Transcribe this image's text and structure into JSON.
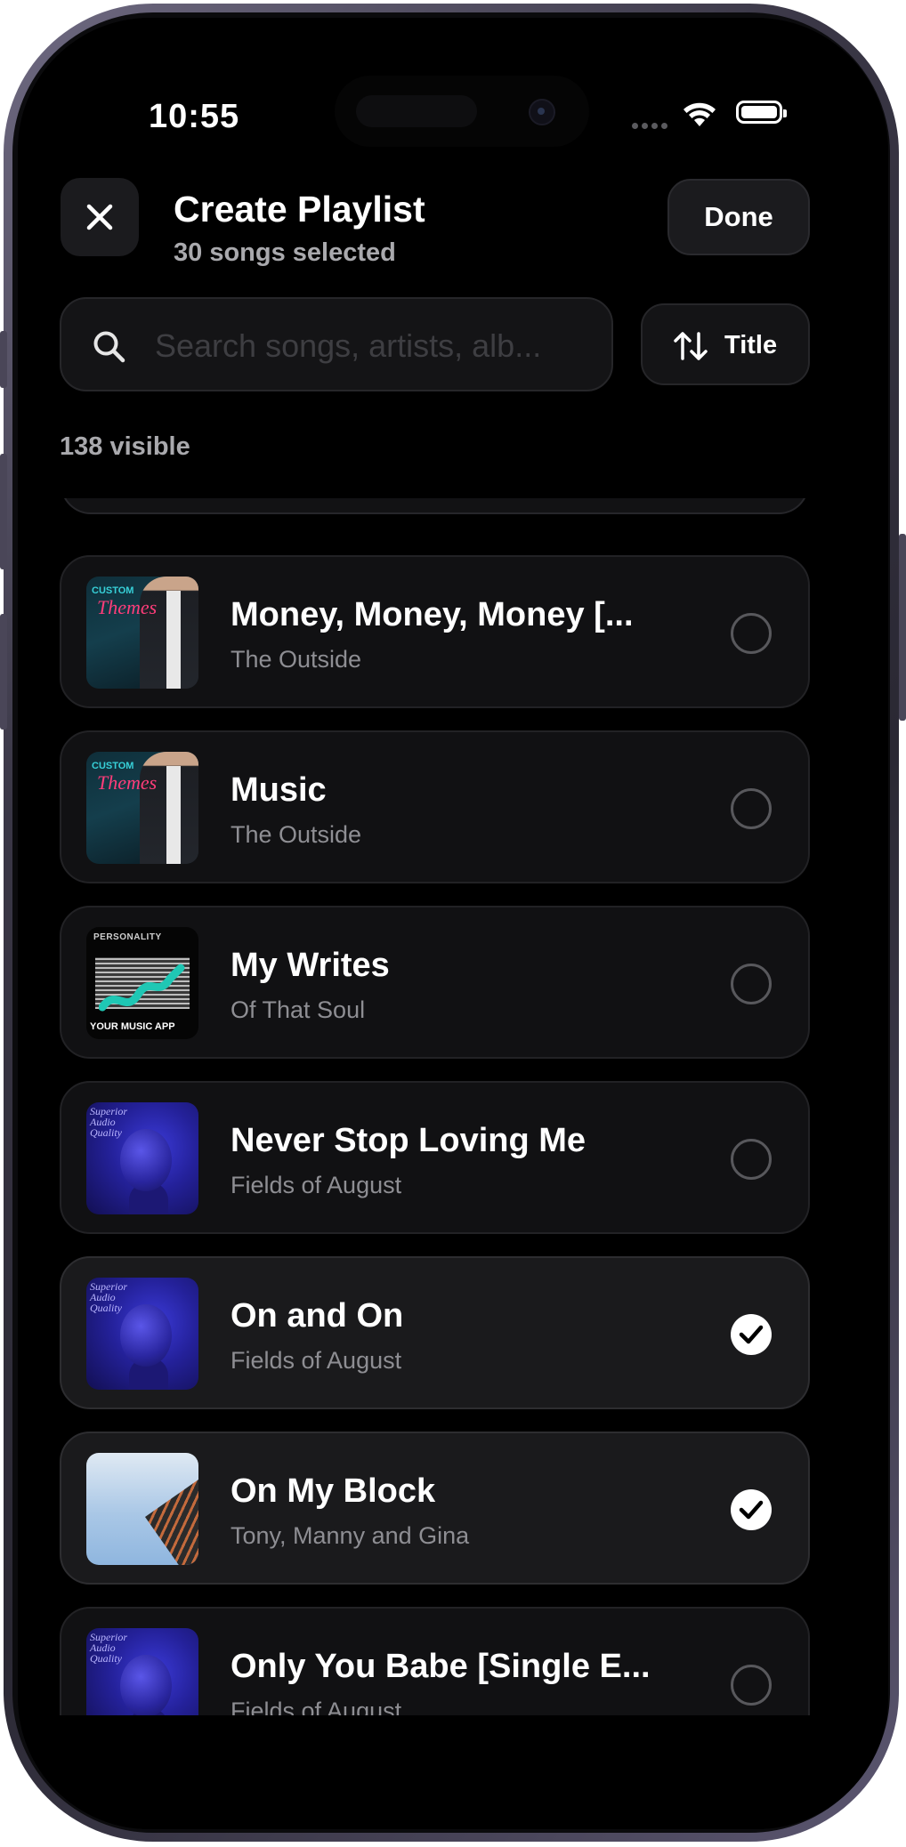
{
  "status_bar": {
    "time": "10:55"
  },
  "header": {
    "title": "Create Playlist",
    "subtitle": "30 songs selected",
    "done_label": "Done"
  },
  "search": {
    "placeholder": "Search songs, artists, alb...",
    "value": ""
  },
  "sort": {
    "label": "Title",
    "icon": "sort-arrows-icon"
  },
  "visible_count": "138 visible",
  "songs": [
    {
      "title": "Money, Money, Money [...",
      "artist": "The Outside",
      "selected": false,
      "art": "custom-themes"
    },
    {
      "title": "Music",
      "artist": "The Outside",
      "selected": false,
      "art": "custom-themes"
    },
    {
      "title": "My Writes",
      "artist": "Of That Soul",
      "selected": false,
      "art": "your-music-app"
    },
    {
      "title": "Never Stop Loving Me",
      "artist": "Fields of August",
      "selected": false,
      "art": "superior-audio-quality"
    },
    {
      "title": "On and On",
      "artist": "Fields of August",
      "selected": true,
      "art": "superior-audio-quality"
    },
    {
      "title": "On My Block",
      "artist": "Tony, Manny and Gina",
      "selected": true,
      "art": "sky-building"
    },
    {
      "title": "Only You Babe [Single E...",
      "artist": "Fields of August",
      "selected": false,
      "art": "superior-audio-quality"
    }
  ],
  "artwork_text": {
    "custom_top": "CUSTOM",
    "custom_script": "Themes",
    "chart_top": "PERSONALITY",
    "chart_bottom": "YOUR MUSIC APP",
    "face_text": "Superior Audio Quality"
  },
  "colors": {
    "background": "#000000",
    "card": "#111113",
    "card_selected": "#1a1a1c",
    "text": "#ffffff",
    "secondary_text": "#8e8e93"
  }
}
